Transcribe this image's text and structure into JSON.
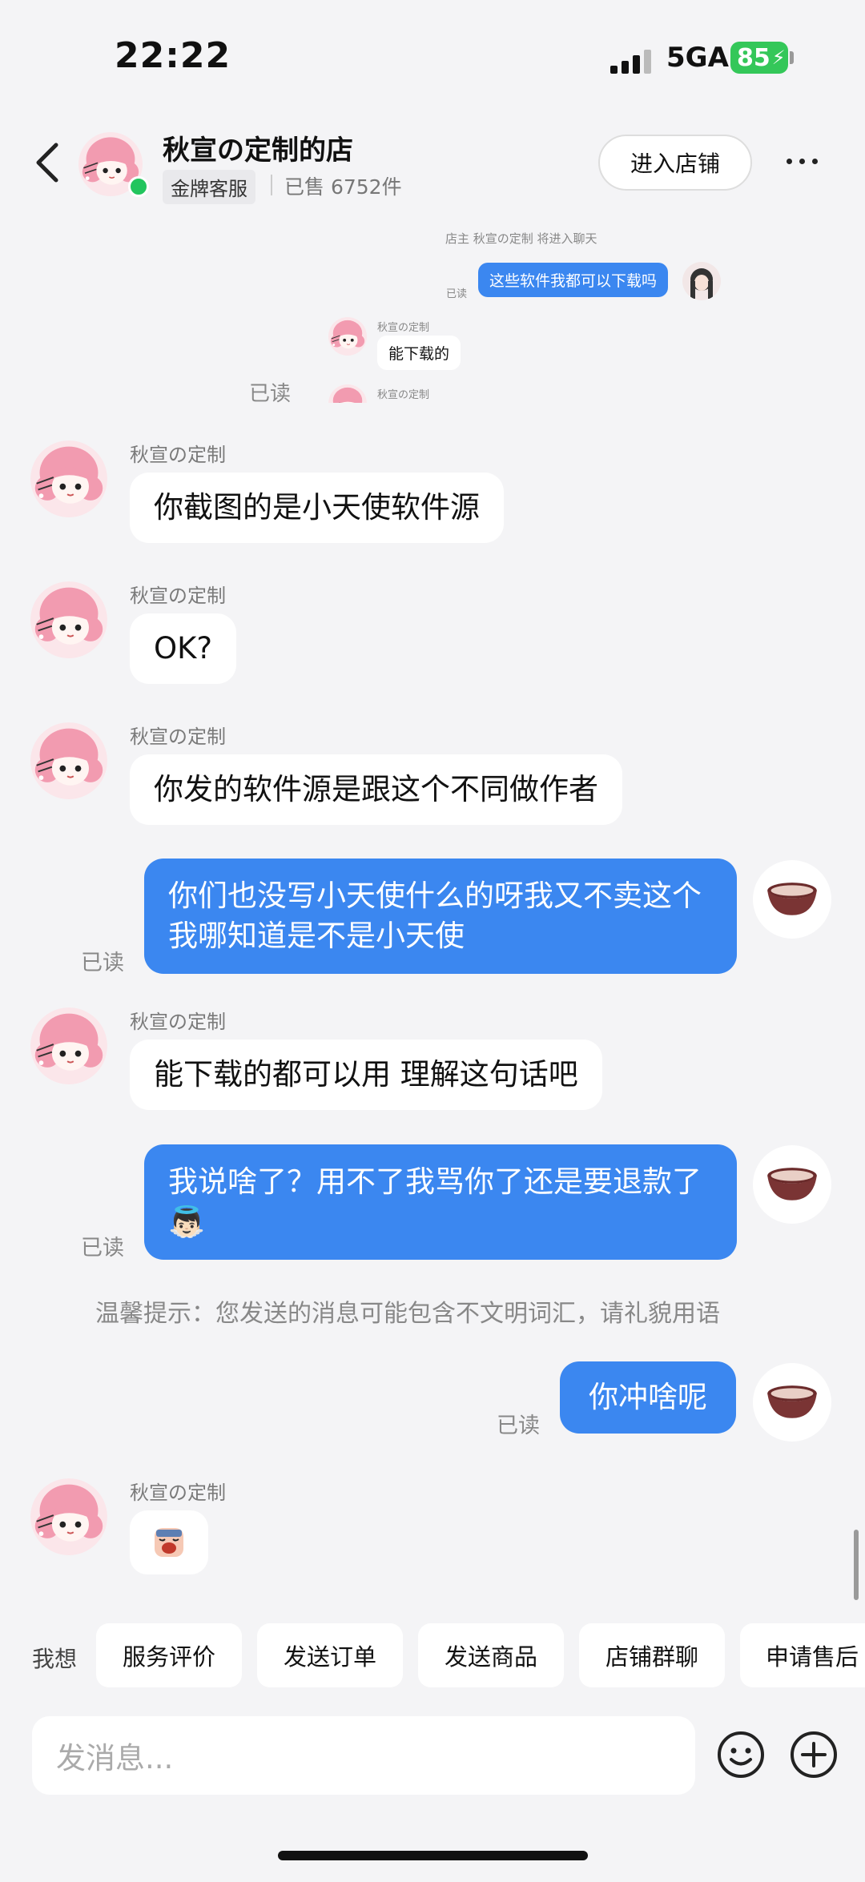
{
  "status": {
    "time": "22:22",
    "network": "5GA",
    "battery": "85"
  },
  "header": {
    "shop_name": "秋宣の定制的店",
    "badge": "金牌客服",
    "sold": "已售 6752件",
    "enter_shop": "进入店铺"
  },
  "shared_screenshot": {
    "system_text": "店主 秋宣の定制 将进入聊天",
    "read_label": "已读",
    "user_message": "这些软件我都可以下载吗",
    "seller_name": "秋宣の定制",
    "seller_reply": "能下载的",
    "read_below": "已读",
    "seller_name_2": "秋宣の定制"
  },
  "messages": [
    {
      "sender": "秋宣の定制",
      "text": "你截图的是小天使软件源"
    },
    {
      "sender": "秋宣の定制",
      "text": "OK?"
    },
    {
      "sender": "秋宣の定制",
      "text": "你发的软件源是跟这个不同做作者"
    },
    {
      "read": "已读",
      "text": "你们也没写小天使什么的呀我又不卖这个我哪知道是不是小天使"
    },
    {
      "sender": "秋宣の定制",
      "text": "能下载的都可以用 理解这句话吧"
    },
    {
      "read": "已读",
      "text": "我说啥了？用不了我骂你了还是要退款了👼🏻"
    },
    {
      "read": "已读",
      "text": "你冲啥呢"
    },
    {
      "sender": "秋宣の定制"
    }
  ],
  "hint": "温馨提示：您发送的消息可能包含不文明词汇，请礼貌用语",
  "quickbar": {
    "label": "我想",
    "buttons": [
      "服务评价",
      "发送订单",
      "发送商品",
      "店铺群聊",
      "申请售后"
    ]
  },
  "input": {
    "placeholder": "发消息..."
  },
  "icons": {
    "emoji": "smiley-icon",
    "add": "plus-circle-icon",
    "back": "chevron-left-icon",
    "more": "more-dots-icon"
  },
  "colors": {
    "bubble_out": "#3b87f0",
    "battery": "#34c759",
    "online": "#22c55e"
  }
}
